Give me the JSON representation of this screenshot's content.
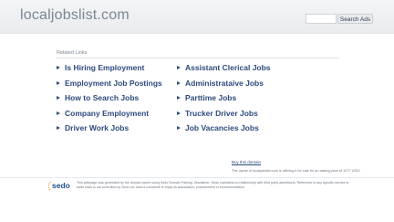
{
  "header": {
    "site_title": "localjobslist.com",
    "search_placeholder": "",
    "search_button": "Search Ads"
  },
  "related": {
    "heading": "Related Links",
    "left": [
      "Is Hiring Employment",
      "Employment Job Postings",
      "How to Search Jobs",
      "Company Employment",
      "Driver Work Jobs"
    ],
    "right": [
      "Assistant Clerical Jobs",
      "Administrataive Jobs",
      "Parttime Jobs",
      "Trucker Driver Jobs",
      "Job Vacancies Jobs"
    ]
  },
  "sale": {
    "buy_label": "Buy this domain",
    "owner_text": "The owner of localjobslist.com is offering it for sale for an asking price of 1077 USD!"
  },
  "footer": {
    "logo_text": "sedo",
    "disclaimer": "This webpage was generated by the domain owner using Sedo Domain Parking. Disclaimer: Sedo maintains no relationship with third party advertisers. Reference to any specific service or trade mark is not controlled by Sedo nor does it constitute or imply its association, endorsement or recommendation."
  }
}
